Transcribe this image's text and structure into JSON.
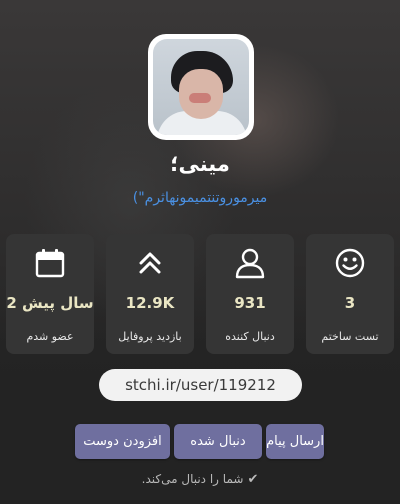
{
  "profile": {
    "name": "مینی؛",
    "bio": "میرموروتنتمیمونهاثرم\")"
  },
  "stats": [
    {
      "icon": "calendar-icon",
      "value": "2 سال پیش",
      "label": "عضو شدم"
    },
    {
      "icon": "chevrons-up-icon",
      "value": "12.9K",
      "label": "بازدید پروفایل"
    },
    {
      "icon": "user-icon",
      "value": "931",
      "label": "دنبال کننده"
    },
    {
      "icon": "smiley-icon",
      "value": "3",
      "label": "تست ساختم"
    }
  ],
  "url": "stchi.ir/user/119212",
  "actions": {
    "add_friend": "افزودن دوست",
    "following": "دنبال شده",
    "send_message": "ارسال پیام"
  },
  "follow_status": "شما را دنبال می‌کند.",
  "colors": {
    "accent_button": "#6f6f9f",
    "stat_value": "#eae6c4",
    "bio_link": "#4a90e2",
    "card_bg": "#353535"
  }
}
